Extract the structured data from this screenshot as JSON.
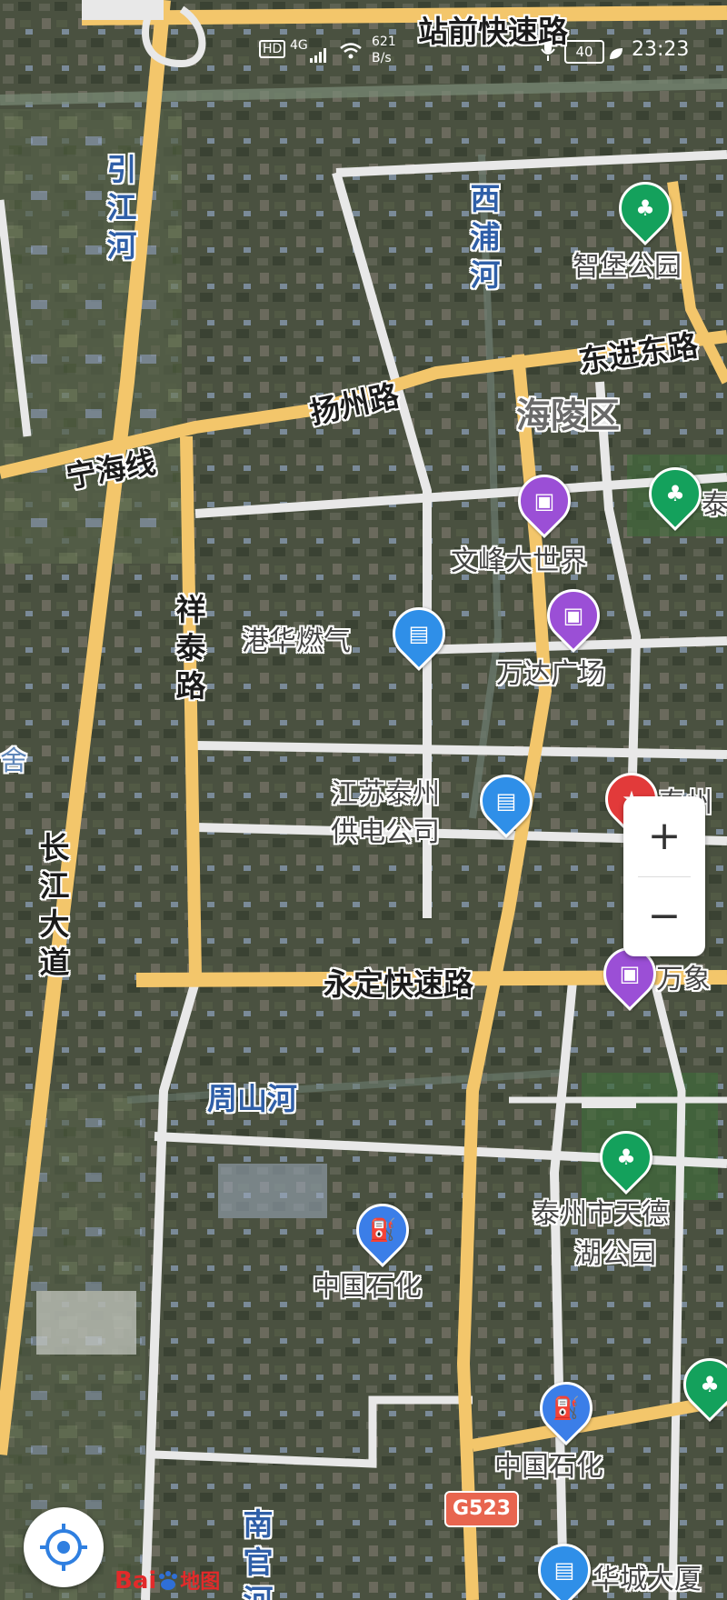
{
  "status_bar": {
    "network": "HD",
    "signal": "4G",
    "speed_value": "621",
    "speed_unit": "B/s",
    "battery": "40",
    "time": "23:23"
  },
  "roads": {
    "zhanqian": "站前快速路",
    "dongjin": "东进东路",
    "yangzhou": "扬州路",
    "ninghai": "宁海线",
    "xiangtai": "祥泰路",
    "changjiang": "长江大道",
    "yongding": "永定快速路",
    "shield": "G523"
  },
  "water": {
    "yinjiang": "引江河",
    "xipu": "西浦河",
    "zhoushan": "周山河",
    "nanguan": "南官河"
  },
  "district": {
    "hailing": "海陵区"
  },
  "pois": {
    "zhibao": "智堡公园",
    "tai_partial": "泰",
    "wenfeng": "文峰大世界",
    "ganghua": "港华燃气",
    "wanda": "万达广场",
    "power_line1": "江苏泰州",
    "power_line2": "供电公司",
    "taizhou_partial": "泰州",
    "wanxiang_partial": "万象",
    "tiande_line1": "泰州市天德",
    "tiande_line2": "湖公园",
    "sinopec1": "中国石化",
    "sinopec2": "中国石化",
    "edge_left": "舍",
    "bottom_partial": "华城大厦"
  },
  "controls": {
    "zoom_in": "+",
    "zoom_out": "−",
    "logo_text": "Bai",
    "logo_map": "地图"
  },
  "colors": {
    "major_road": "#f3c66b",
    "minor_road": "#e8e8e8",
    "poi_park": "#14a15c",
    "poi_shop": "#9b4fd6",
    "poi_service": "#2f8fe8",
    "poi_gas": "#3b7ee8",
    "poi_landmark": "#e23a3a"
  }
}
